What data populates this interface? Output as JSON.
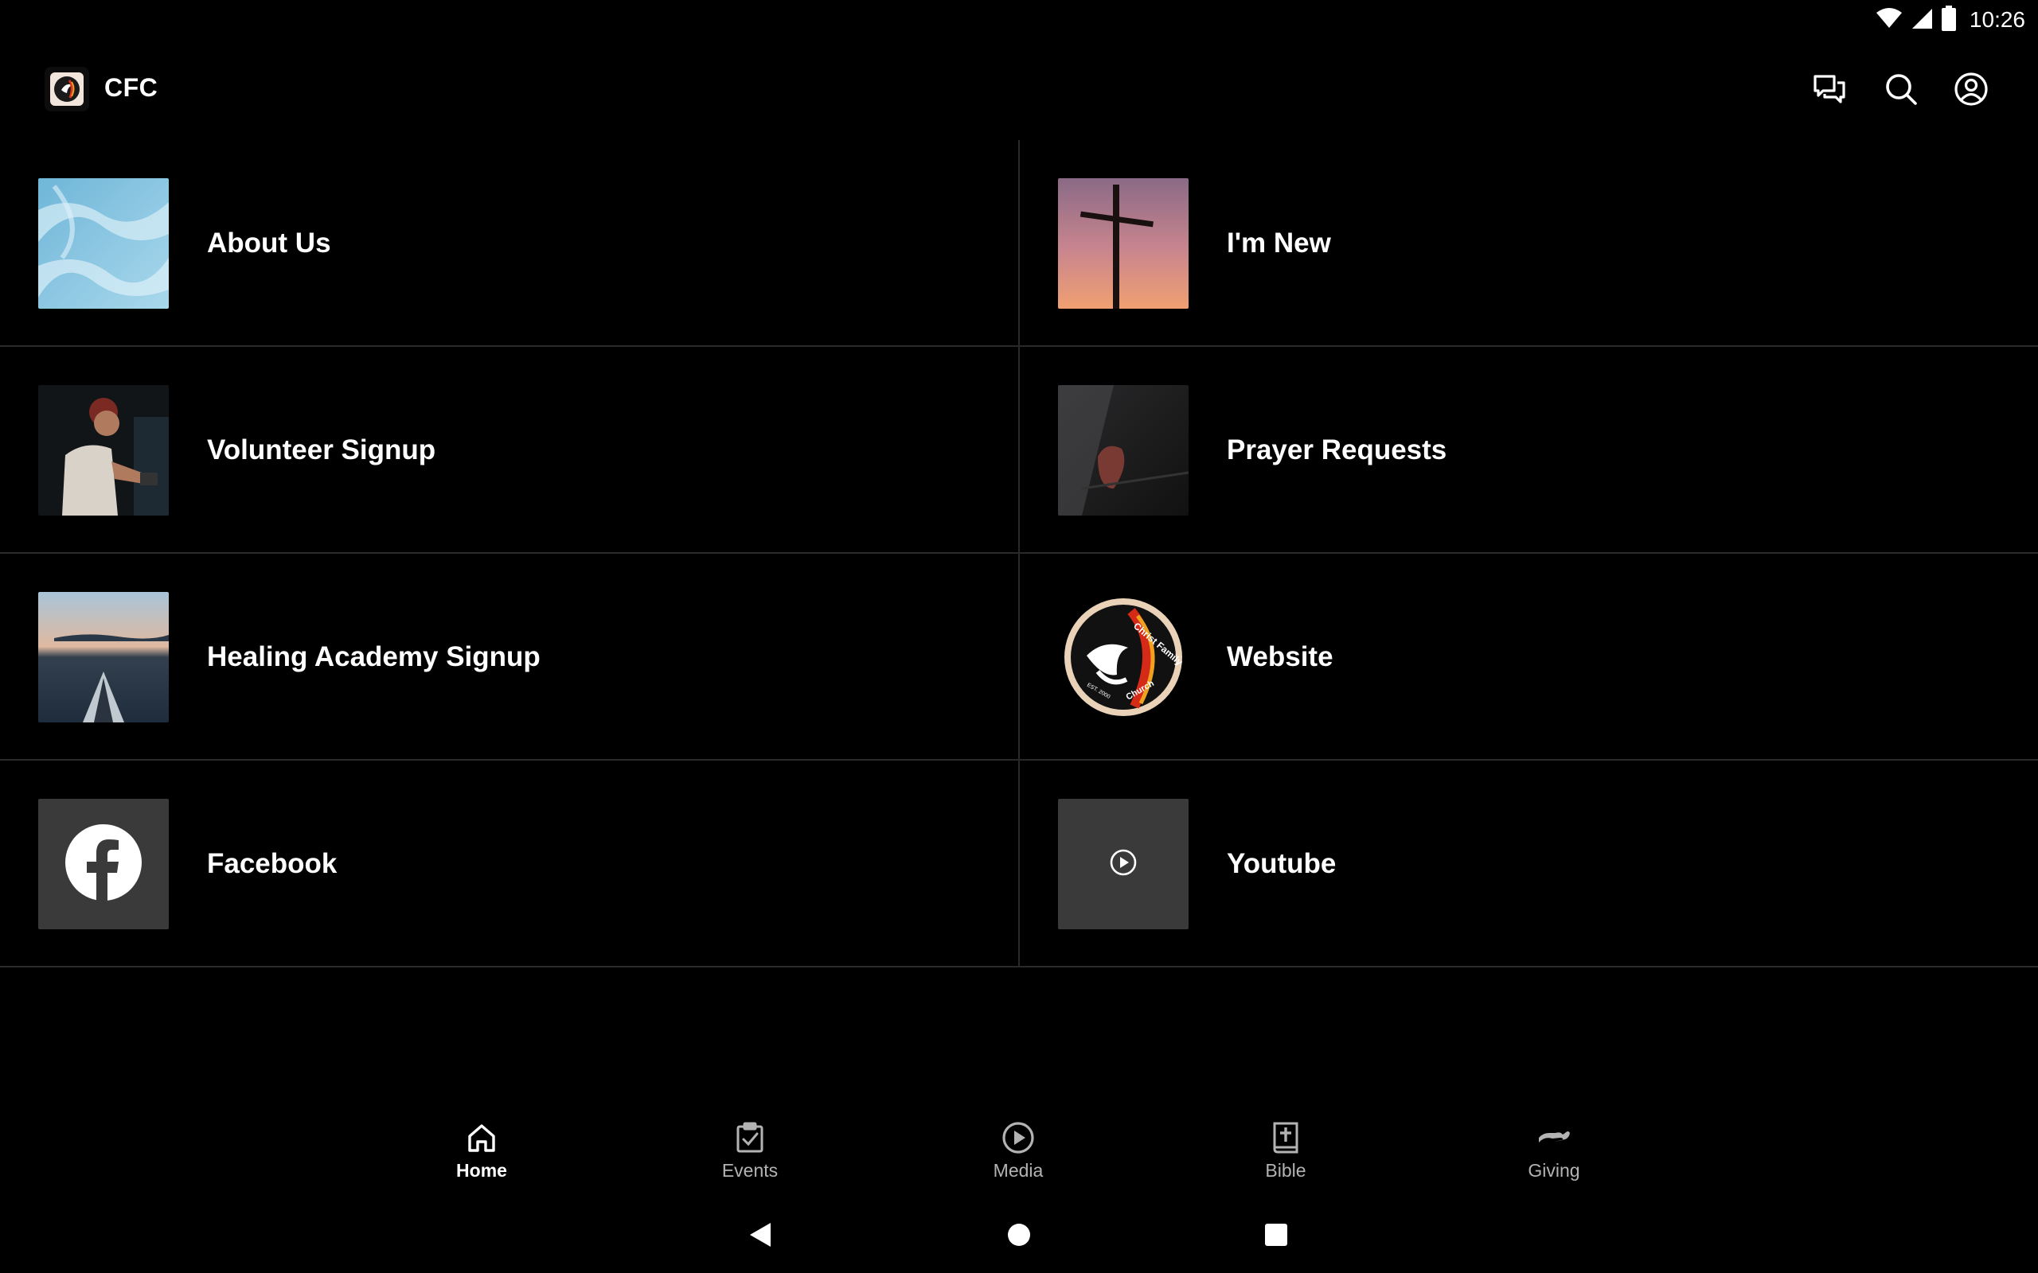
{
  "status_bar": {
    "time": "10:26",
    "icons": [
      "wifi-icon",
      "cell-signal-icon",
      "battery-icon"
    ]
  },
  "app_bar": {
    "title": "CFC",
    "logo": "church-logo",
    "actions": [
      "chat-icon",
      "search-icon",
      "account-icon"
    ]
  },
  "tiles": [
    {
      "label": "About Us",
      "thumb": "sky-photo"
    },
    {
      "label": "I'm New",
      "thumb": "cross-sunset-photo"
    },
    {
      "label": "Volunteer Signup",
      "thumb": "volunteer-photo"
    },
    {
      "label": "Prayer Requests",
      "thumb": "praying-hands-photo"
    },
    {
      "label": "Healing Academy Signup",
      "thumb": "kayak-lake-photo"
    },
    {
      "label": "Website",
      "thumb": "church-seal"
    },
    {
      "label": "Facebook",
      "thumb": "facebook-icon"
    },
    {
      "label": "Youtube",
      "thumb": "play-icon"
    }
  ],
  "seal": {
    "top_text": "Christ Family",
    "bottom_text": "Church",
    "est": "EST. 2000"
  },
  "bottom_nav": [
    {
      "label": "Home",
      "icon": "home-icon",
      "active": true
    },
    {
      "label": "Events",
      "icon": "events-icon",
      "active": false
    },
    {
      "label": "Media",
      "icon": "play-circle-icon",
      "active": false
    },
    {
      "label": "Bible",
      "icon": "bible-icon",
      "active": false
    },
    {
      "label": "Giving",
      "icon": "giving-hand-icon",
      "active": false
    }
  ],
  "system_nav": [
    "back-icon",
    "home-circle-icon",
    "recents-icon"
  ],
  "colors": {
    "background": "#000000",
    "divider": "#2a2a2a",
    "placeholder_tile": "#3a3a3a",
    "inactive_nav": "#b3b3b3"
  }
}
